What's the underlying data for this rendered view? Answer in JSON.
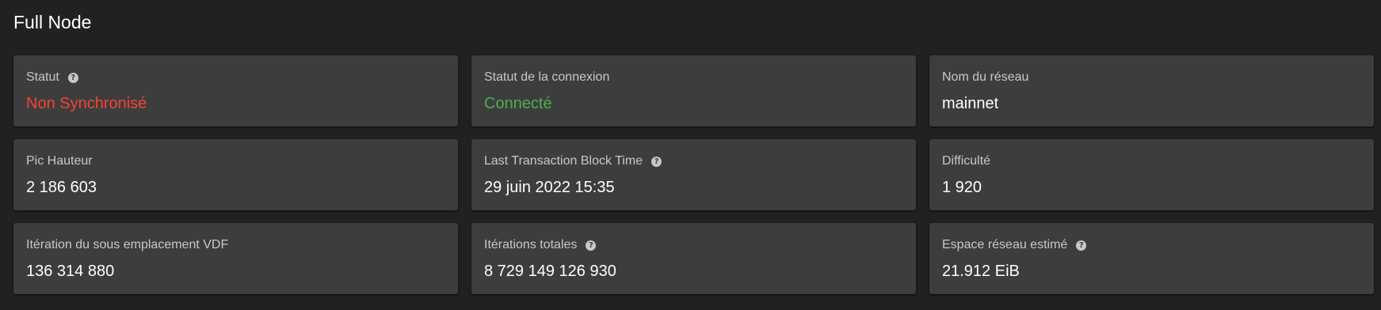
{
  "page": {
    "title": "Full Node"
  },
  "cards": {
    "status": {
      "label": "Statut",
      "value": "Non Synchronisé"
    },
    "connection_status": {
      "label": "Statut de la connexion",
      "value": "Connecté"
    },
    "network_name": {
      "label": "Nom du réseau",
      "value": "mainnet"
    },
    "peak_height": {
      "label": "Pic Hauteur",
      "value": "2 186 603"
    },
    "last_tx_block_time": {
      "label": "Last Transaction Block Time",
      "value": "29 juin 2022 15:35"
    },
    "difficulty": {
      "label": "Difficulté",
      "value": "1 920"
    },
    "vdf_sub_slot_iters": {
      "label": "Itération du sous emplacement VDF",
      "value": "136 314 880"
    },
    "total_iterations": {
      "label": "Itérations totales",
      "value": "8 729 149 126 930"
    },
    "estimated_netspace": {
      "label": "Espace réseau estimé",
      "value": "21.912 EiB"
    }
  },
  "icons": {
    "help": "help-circle-icon"
  },
  "colors": {
    "background": "#212121",
    "card": "#3d3d3d",
    "error": "#f44336",
    "success": "#4caf50"
  }
}
